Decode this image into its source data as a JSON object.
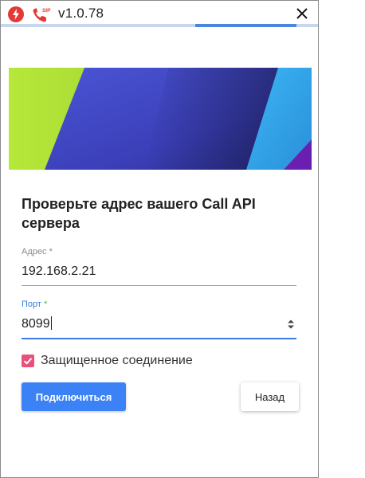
{
  "titlebar": {
    "version": "v1.0.78",
    "sip_badge": "SIP",
    "progress": 0.32
  },
  "form": {
    "heading": "Проверьте адрес вашего Call API сервера",
    "address": {
      "label": "Адрес",
      "required_mark": "*",
      "value": "192.168.2.21"
    },
    "port": {
      "label": "Порт",
      "required_mark": "*",
      "value": "8099"
    },
    "secure": {
      "label": "Защищенное соединение",
      "checked": true
    },
    "connect_label": "Подключиться",
    "back_label": "Назад"
  },
  "colors": {
    "accent": "#3b82f6",
    "focus": "#3b7ddd",
    "checkbox": "#e8527a",
    "danger": "#e53935"
  }
}
